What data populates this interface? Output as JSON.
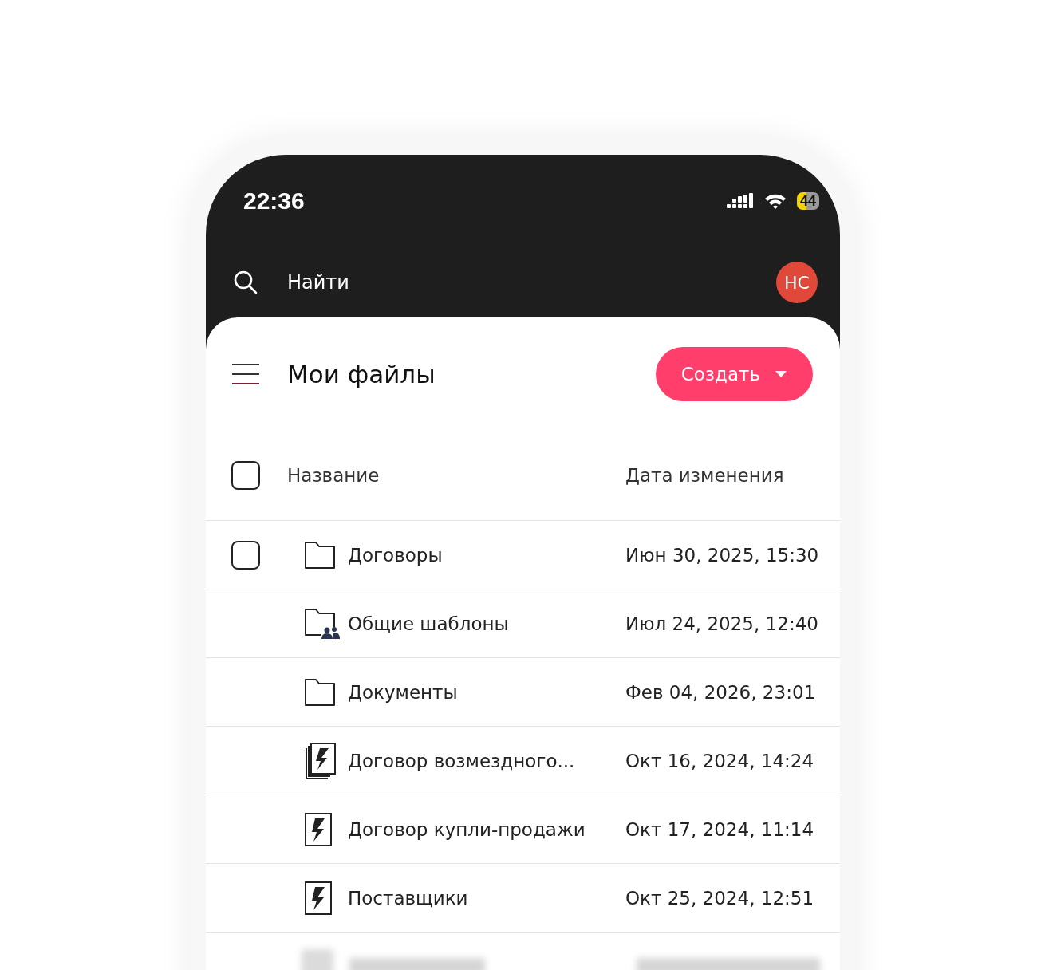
{
  "status_bar": {
    "time": "22:36",
    "battery": "44"
  },
  "search": {
    "placeholder": "Найти"
  },
  "avatar": {
    "initials": "НС",
    "color": "#e0483a"
  },
  "header": {
    "title": "Мои файлы",
    "create_button": "Создать"
  },
  "table": {
    "columns": [
      "Название",
      "Дата изменения"
    ],
    "select_all": {
      "checked": false
    },
    "rows": [
      {
        "kind": "folder",
        "name": "Договоры",
        "date": "Июн 30, 2025, 15:30",
        "checked": false
      },
      {
        "kind": "shared-folder",
        "name": "Общие шаблоны",
        "date": "Июл 24, 2025, 12:40"
      },
      {
        "kind": "folder",
        "name": "Документы",
        "date": "Фев 04, 2026, 23:01"
      },
      {
        "kind": "document-stack",
        "name": "Договор возмездного...",
        "date": "Окт 16, 2024, 14:24"
      },
      {
        "kind": "document",
        "name": "Договор купли-продажи",
        "date": "Окт 17, 2024, 11:14"
      },
      {
        "kind": "document",
        "name": "Поставщики",
        "date": "Окт 25, 2024, 12:51"
      }
    ]
  }
}
